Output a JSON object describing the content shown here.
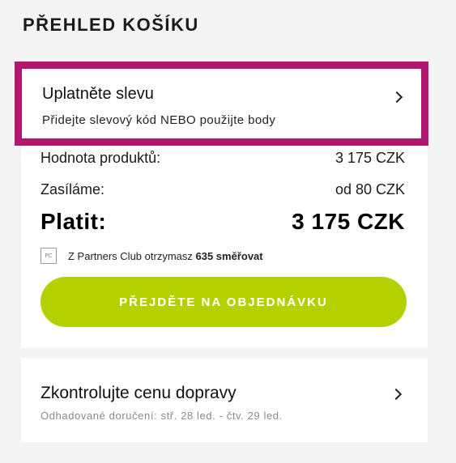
{
  "heading": "PŘEHLED KOŠÍKU",
  "discount": {
    "title": "Uplatněte slevu",
    "subtitle": "Přidejte slevový kód NEBO použijte body",
    "highlight_color": "#b3166e"
  },
  "summary": {
    "products_label": "Hodnota produktů:",
    "products_value": "3 175 CZK",
    "shipping_label": "Zasíláme:",
    "shipping_value": "od 80 CZK",
    "total_label": "Platit:",
    "total_value": "3 175 CZK"
  },
  "partners": {
    "icon_text": "PC",
    "text": "Z Partners Club otrzymasz",
    "points": "635 směřovat"
  },
  "cta": {
    "label": "PŘEJDĚTE NA OBJEDNÁVKU",
    "color": "#b5d000"
  },
  "shipping_check": {
    "title": "Zkontrolujte cenu dopravy",
    "subtitle": "Odhadované doručení: stř. 28 led. - čtv. 29 led."
  }
}
